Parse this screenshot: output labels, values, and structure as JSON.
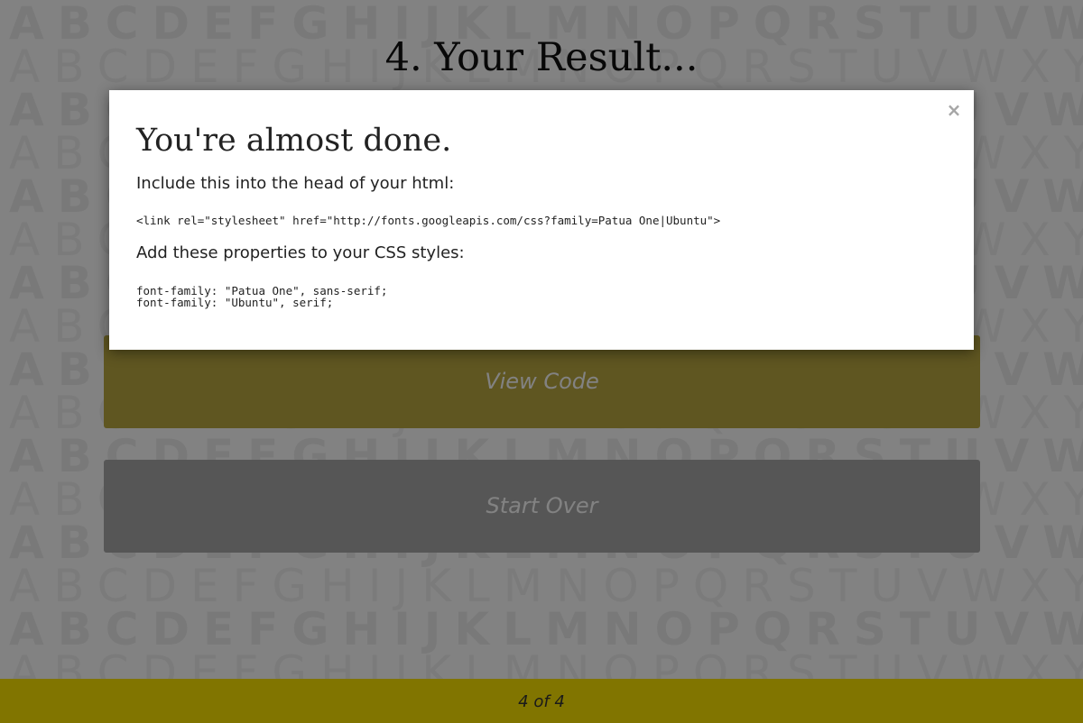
{
  "background": {
    "letters": "ABCDEFGHIJKLMNOPQRSTUVWXYZAB"
  },
  "page": {
    "title": "4. Your Result..."
  },
  "buttons": {
    "view_code": "View Code",
    "start_over": "Start Over"
  },
  "footer": {
    "progress": "4 of 4"
  },
  "modal": {
    "close_label": "×",
    "heading": "You're almost done.",
    "head_instruction": "Include this into the head of your html:",
    "link_code": "<link rel=\"stylesheet\" href=\"http://fonts.googleapis.com/css?family=Patua One|Ubuntu\">",
    "css_instruction": "Add these properties to your CSS styles:",
    "css_lines": [
      "font-family: \"Patua One\", sans-serif;",
      "font-family: \"Ubuntu\", serif;"
    ]
  },
  "colors": {
    "view_code_button": "#bba942",
    "start_over_button": "#aaaaaa",
    "footer": "#fde500",
    "overlay": "rgba(0,0,0,0.49)"
  }
}
